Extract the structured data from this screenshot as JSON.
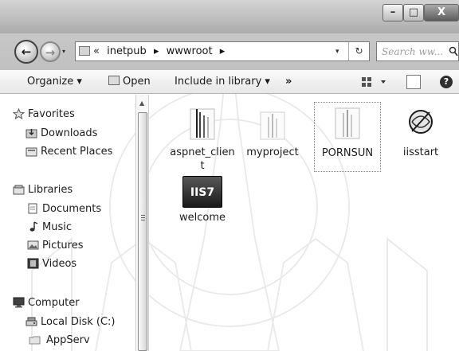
{
  "window": {
    "caption_buttons": {
      "minimize": "–",
      "maximize": "□",
      "close": "X"
    }
  },
  "navigation": {
    "back_arrow": "←",
    "forward_arrow": "→"
  },
  "address": {
    "overflow": "«",
    "crumbs": [
      "inetpub",
      "wwwroot"
    ],
    "separator": "▸",
    "dropdown": "▾",
    "refresh": "↻"
  },
  "search": {
    "placeholder": "Search ww..."
  },
  "toolbar": {
    "organize": "Organize ▾",
    "open": "Open",
    "include_in_library": "Include in library ▾",
    "more": "»",
    "help": "?"
  },
  "sidebar": {
    "favorites": {
      "label": "Favorites",
      "items": [
        "Downloads",
        "Recent Places"
      ]
    },
    "libraries": {
      "label": "Libraries",
      "items": [
        "Documents",
        "Music",
        "Pictures",
        "Videos"
      ]
    },
    "computer": {
      "label": "Computer",
      "items": [
        "Local Disk (C:)",
        "AppServ"
      ]
    }
  },
  "files": [
    {
      "name": "aspnet_client",
      "type": "folder"
    },
    {
      "name": "myproject",
      "type": "folder"
    },
    {
      "name": "PORNSUN",
      "type": "folder",
      "selected": true
    },
    {
      "name": "iisstart",
      "type": "web-page"
    },
    {
      "name": "welcome",
      "type": "image",
      "thumb_text": "IIS7"
    }
  ],
  "colors": {
    "accent": "#3c3c3c",
    "titlebar": "#bdbdbd"
  }
}
